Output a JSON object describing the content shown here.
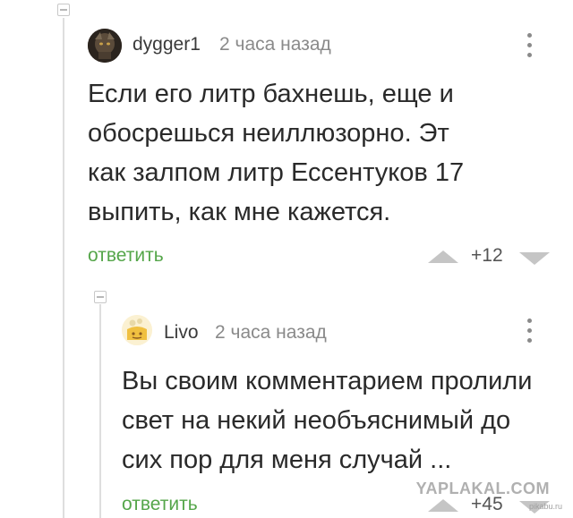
{
  "comments": [
    {
      "username": "dygger1",
      "time": "2 часа назад",
      "text": "Если его литр бахнешь, еще и обосрешься неиллюзорно. Эт как залпом литр Ессентуков 17 выпить, как мне кажется.",
      "reply_label": "ответить",
      "score": "+12"
    },
    {
      "username": "Livo",
      "time": "2 часа назад",
      "text": "Вы своим комментарием пролили свет на некий необъяснимый до сих пор для меня случай ...",
      "reply_label": "ответить",
      "score": "+45"
    }
  ],
  "watermark": {
    "text": "YAPLAKAL.COM",
    "sub": "pikabu.ru"
  },
  "colors": {
    "reply_link": "#55a64a",
    "vote_arrow": "#c5c5c5",
    "thread_line": "#dedede"
  }
}
